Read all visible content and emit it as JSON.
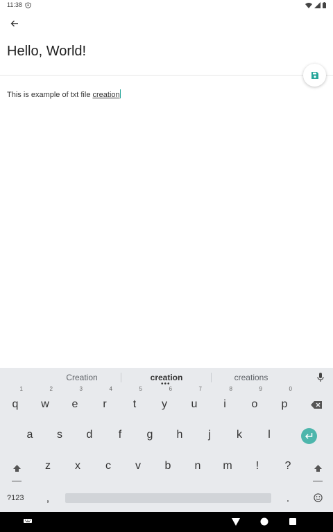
{
  "status_bar": {
    "time": "11:38",
    "icons": [
      "vpn-icon",
      "wifi-icon",
      "signal-icon",
      "battery-icon"
    ]
  },
  "app_bar": {
    "back_icon": "back-arrow-icon",
    "title": "Hello, World!",
    "save_icon": "save-icon"
  },
  "editor": {
    "text_before": "This is example of txt file ",
    "text_composing": "creation"
  },
  "keyboard": {
    "suggestions": [
      "Creation",
      "creation",
      "creations"
    ],
    "row1": [
      {
        "key": "q",
        "hint": "1"
      },
      {
        "key": "w",
        "hint": "2"
      },
      {
        "key": "e",
        "hint": "3"
      },
      {
        "key": "r",
        "hint": "4"
      },
      {
        "key": "t",
        "hint": "5"
      },
      {
        "key": "y",
        "hint": "6"
      },
      {
        "key": "u",
        "hint": "7"
      },
      {
        "key": "i",
        "hint": "8"
      },
      {
        "key": "o",
        "hint": "9"
      },
      {
        "key": "p",
        "hint": "0"
      }
    ],
    "row2": [
      "a",
      "s",
      "d",
      "f",
      "g",
      "h",
      "j",
      "k",
      "l"
    ],
    "row3": [
      "z",
      "x",
      "c",
      "v",
      "b",
      "n",
      "m",
      "!",
      "?"
    ],
    "bottom": {
      "symbols": "?123",
      "comma": ",",
      "period": "."
    },
    "accent_color": "#4db6ac"
  },
  "nav_bar": {
    "icons": [
      "keyboard-switch-icon",
      "back-triangle-icon",
      "home-circle-icon",
      "recents-square-icon"
    ]
  }
}
